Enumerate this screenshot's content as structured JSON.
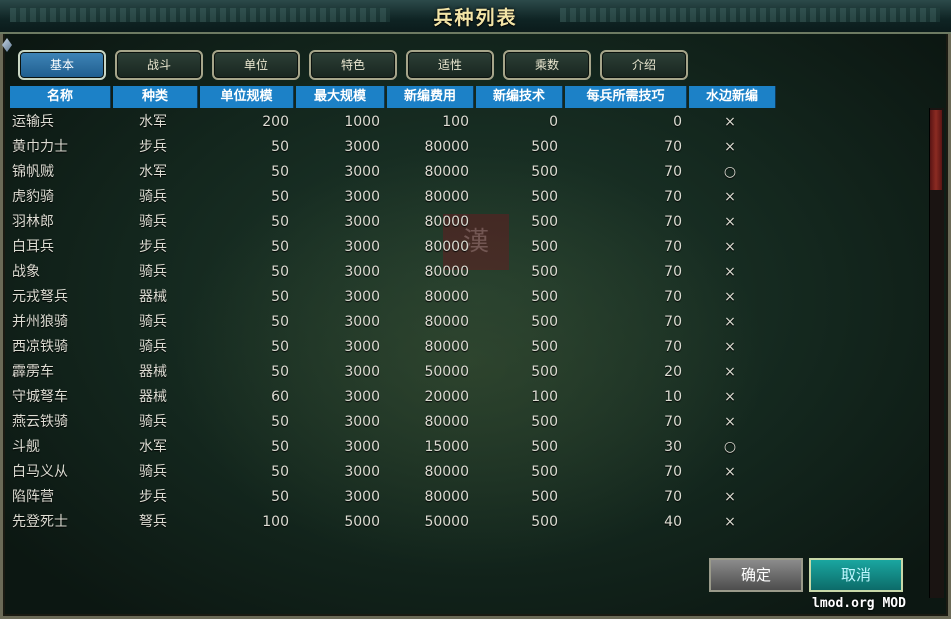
{
  "window": {
    "title": "兵种列表"
  },
  "tabs": [
    "基本",
    "战斗",
    "单位",
    "特色",
    "适性",
    "乘数",
    "介绍"
  ],
  "active_tab": "基本",
  "columns": [
    "名称",
    "种类",
    "单位规模",
    "最大规模",
    "新编费用",
    "新编技术",
    "每兵所需技巧",
    "水边新编"
  ],
  "rows": [
    [
      "运输兵",
      "水军",
      "200",
      "1000",
      "100",
      "0",
      "0",
      "×"
    ],
    [
      "黄巾力士",
      "步兵",
      "50",
      "3000",
      "80000",
      "500",
      "70",
      "×"
    ],
    [
      "锦帆贼",
      "水军",
      "50",
      "3000",
      "80000",
      "500",
      "70",
      "○"
    ],
    [
      "虎豹骑",
      "骑兵",
      "50",
      "3000",
      "80000",
      "500",
      "70",
      "×"
    ],
    [
      "羽林郎",
      "骑兵",
      "50",
      "3000",
      "80000",
      "500",
      "70",
      "×"
    ],
    [
      "白耳兵",
      "步兵",
      "50",
      "3000",
      "80000",
      "500",
      "70",
      "×"
    ],
    [
      "战象",
      "骑兵",
      "50",
      "3000",
      "80000",
      "500",
      "70",
      "×"
    ],
    [
      "元戎弩兵",
      "器械",
      "50",
      "3000",
      "80000",
      "500",
      "70",
      "×"
    ],
    [
      "并州狼骑",
      "骑兵",
      "50",
      "3000",
      "80000",
      "500",
      "70",
      "×"
    ],
    [
      "西凉铁骑",
      "骑兵",
      "50",
      "3000",
      "80000",
      "500",
      "70",
      "×"
    ],
    [
      "霹雳车",
      "器械",
      "50",
      "3000",
      "50000",
      "500",
      "20",
      "×"
    ],
    [
      "守城弩车",
      "器械",
      "60",
      "3000",
      "20000",
      "100",
      "10",
      "×"
    ],
    [
      "燕云铁骑",
      "骑兵",
      "50",
      "3000",
      "80000",
      "500",
      "70",
      "×"
    ],
    [
      "斗舰",
      "水军",
      "50",
      "3000",
      "15000",
      "500",
      "30",
      "○"
    ],
    [
      "白马义从",
      "骑兵",
      "50",
      "3000",
      "80000",
      "500",
      "70",
      "×"
    ],
    [
      "陷阵营",
      "步兵",
      "50",
      "3000",
      "80000",
      "500",
      "70",
      "×"
    ],
    [
      "先登死士",
      "弩兵",
      "100",
      "5000",
      "50000",
      "500",
      "40",
      "×"
    ]
  ],
  "map_mark": "漢",
  "buttons": {
    "ok": "确定",
    "cancel": "取消"
  },
  "credit": "lmod.org  MOD"
}
